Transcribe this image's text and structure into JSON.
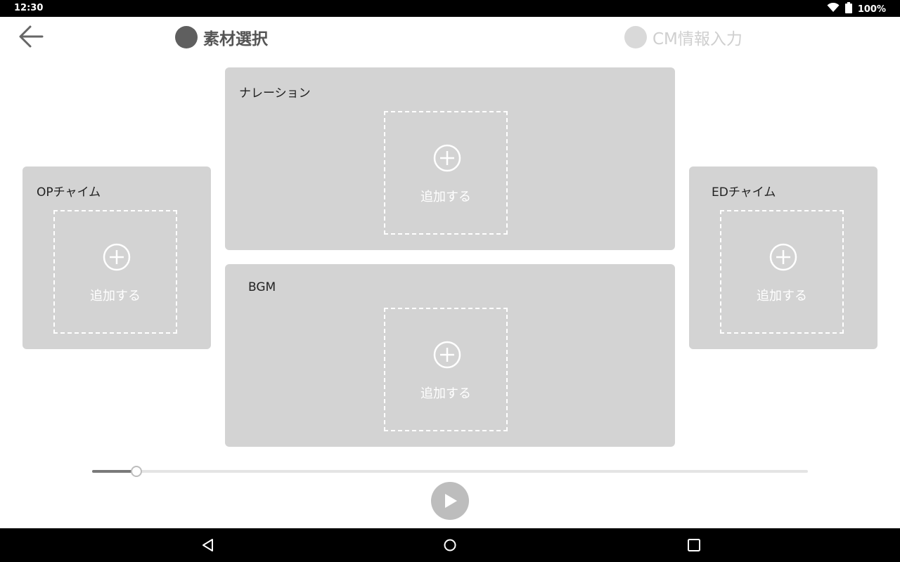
{
  "status_bar": {
    "time": "12:30",
    "battery": "100%",
    "icons": [
      "wifi-icon",
      "battery-icon"
    ]
  },
  "header": {
    "back_icon": "arrow-left-icon",
    "steps": [
      {
        "label": "素材選択",
        "active": true
      },
      {
        "label": "CM情報入力",
        "active": false
      }
    ]
  },
  "panels": {
    "narration": {
      "title": "ナレーション",
      "add_label": "追加する"
    },
    "bgm": {
      "title": "BGM",
      "add_label": "追加する"
    },
    "op_chime": {
      "title": "OPチャイム",
      "add_label": "追加する"
    },
    "ed_chime": {
      "title": "EDチャイム",
      "add_label": "追加する"
    }
  },
  "player": {
    "progress": 0.062,
    "play_icon": "play-icon"
  },
  "nav_bar": {
    "icons": [
      "nav-back-icon",
      "nav-home-icon",
      "nav-recents-icon"
    ]
  },
  "colors": {
    "panel": "#d3d3d3",
    "active_step": "#5f5f5f",
    "inactive_step": "#d9d9d9",
    "play_button": "#bdbdbd"
  }
}
